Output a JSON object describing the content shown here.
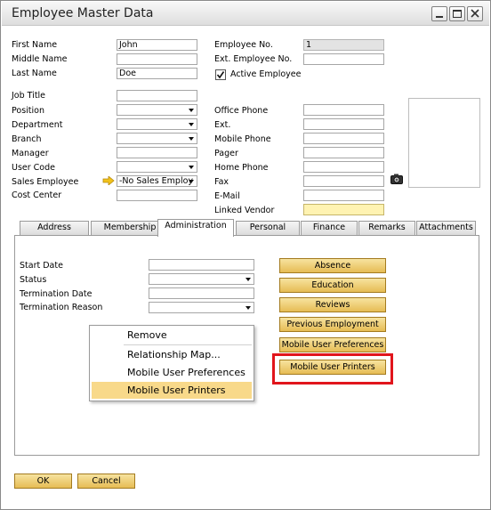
{
  "window": {
    "title": "Employee Master Data"
  },
  "fields_left": [
    {
      "label": "First Name",
      "value": "John"
    },
    {
      "label": "Middle Name",
      "value": ""
    },
    {
      "label": "Last Name",
      "value": "Doe"
    }
  ],
  "fields_right_top": [
    {
      "label": "Employee No.",
      "value": "1"
    },
    {
      "label": "Ext. Employee No.",
      "value": ""
    }
  ],
  "active_employee": {
    "label": "Active Employee",
    "checked": true
  },
  "fields_left2": [
    {
      "label": "Job Title",
      "value": ""
    },
    {
      "label": "Position",
      "value": ""
    },
    {
      "label": "Department",
      "value": ""
    },
    {
      "label": "Branch",
      "value": ""
    },
    {
      "label": "Manager",
      "value": ""
    },
    {
      "label": "User Code",
      "value": ""
    },
    {
      "label": "Sales Employee",
      "value": "-No Sales Employ"
    },
    {
      "label": "Cost Center",
      "value": ""
    }
  ],
  "fields_right2": [
    {
      "label": "Office Phone",
      "value": ""
    },
    {
      "label": "Ext.",
      "value": ""
    },
    {
      "label": "Mobile Phone",
      "value": ""
    },
    {
      "label": "Pager",
      "value": ""
    },
    {
      "label": "Home Phone",
      "value": ""
    },
    {
      "label": "Fax",
      "value": ""
    },
    {
      "label": "E-Mail",
      "value": ""
    },
    {
      "label": "Linked Vendor",
      "value": ""
    }
  ],
  "tabs": [
    "Address",
    "Membership",
    "Administration",
    "Personal",
    "Finance",
    "Remarks",
    "Attachments"
  ],
  "active_tab": "Administration",
  "admin": {
    "start_date": {
      "label": "Start Date",
      "value": ""
    },
    "status": {
      "label": "Status",
      "value": ""
    },
    "termination_date": {
      "label": "Termination Date",
      "value": ""
    },
    "termination_reason": {
      "label": "Termination Reason",
      "value": ""
    }
  },
  "side_buttons": [
    "Absence",
    "Education",
    "Reviews",
    "Previous Employment",
    "Mobile User Preferences",
    "Mobile User Printers"
  ],
  "context_menu": [
    "Remove",
    "Relationship Map...",
    "Mobile User Preferences",
    "Mobile User Printers"
  ],
  "footer": {
    "ok": "OK",
    "cancel": "Cancel"
  },
  "colors": {
    "button_gold": "#e6bc55",
    "highlight": "#f8d98a",
    "callout_red": "#e1151c"
  }
}
